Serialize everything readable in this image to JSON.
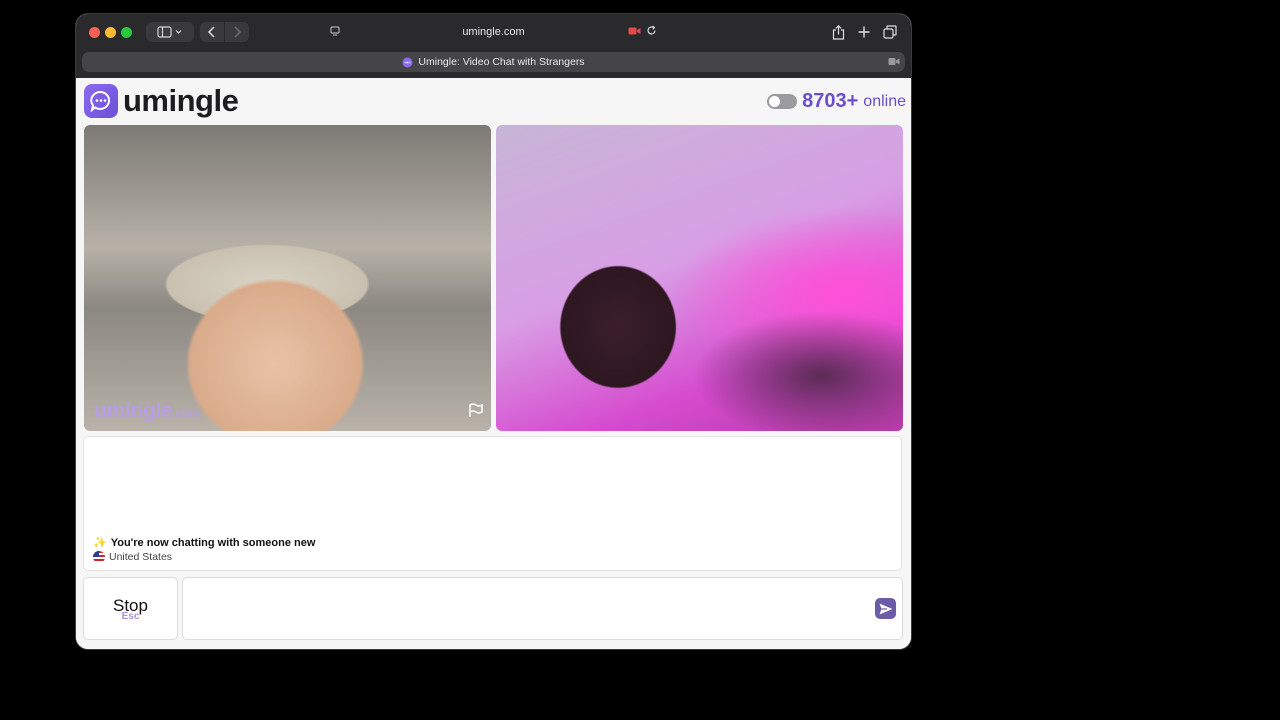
{
  "browser": {
    "url": "umingle.com",
    "tab_title": "Umingle: Video Chat with Strangers"
  },
  "site": {
    "logo_text": "umingle",
    "online_count": "8703+",
    "online_label": "online",
    "accent_color": "#6b4fca"
  },
  "video": {
    "watermark_main": "umingle",
    "watermark_suffix": ".com"
  },
  "chat": {
    "system_emoji": "✨",
    "system_message": "You're now chatting with someone new",
    "partner_country": "United States"
  },
  "controls": {
    "stop_label": "Stop",
    "stop_shortcut": "Esc",
    "message_placeholder": ""
  }
}
